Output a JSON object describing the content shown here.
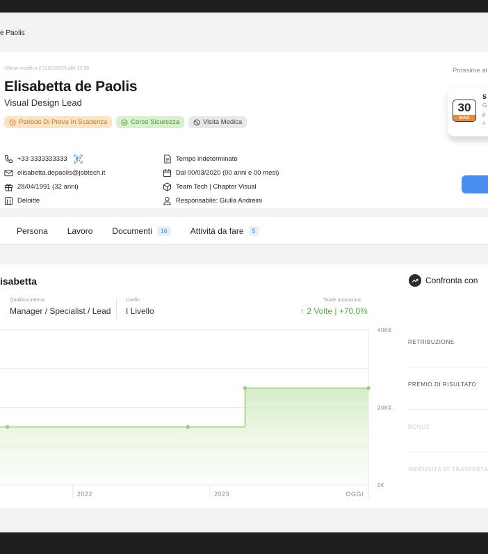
{
  "breadcrumb": "e Paolis",
  "profile": {
    "updated": "Ultima modifica il 31/01/2023 alle 12:08",
    "name": "Elisabetta de Paolis",
    "role": "Visual Design Lead",
    "badges": [
      "Periodo Di Prova In Scadenza",
      "Corso Sicurezza",
      "Visita Medica"
    ],
    "phone": "+33 3333333333",
    "email": "elisabetta.depaolis@jobtech.it",
    "birth": "28/04/1991 (32 anni)",
    "company": "Deloitte",
    "contract": "Tempo indeterminato",
    "since": "Dal 00/03/2020 (00 anni e 00 mesi)",
    "team": "Team Tech | Chapter Visual",
    "manager": "Responsabile: Giulia Andreini"
  },
  "upcoming": {
    "label": "Prossime at",
    "day": "30",
    "month": "MAG",
    "line1": "S",
    "line2": "G",
    "line3": "p",
    "line4": "A"
  },
  "tabs": [
    {
      "label": "Persona",
      "count": ""
    },
    {
      "label": "Lavoro",
      "count": ""
    },
    {
      "label": "Documenti",
      "count": "16"
    },
    {
      "label": "Attività da fare",
      "count": "5"
    }
  ],
  "career": {
    "name": "isabetta",
    "qualifica_label": "Qualifica interna",
    "qualifica_value": "Manager / Specialist / Lead",
    "livello_label": "Livello",
    "livello_value": "I Livello",
    "promo_label": "Totale promozioni",
    "promo_count": "↑ 2 Volte",
    "promo_pct": "+70,0%",
    "compare": "Confronta con",
    "metrics": [
      "RETRIBUZIONE",
      "PREMIO DI RISULTATO",
      "BONUS",
      "INDENNITÀ DI TRASFERTA"
    ]
  },
  "colors": {
    "accent_blue": "#4a8ff0",
    "line_green": "#9ccf7f",
    "promo_green": "#4fae3b"
  },
  "chart_data": {
    "type": "area",
    "x_ticks": [
      "2022",
      "2023",
      "OGGI"
    ],
    "y_ticks": [
      "40K€",
      "20K€",
      "0€"
    ],
    "ylim": [
      0,
      40000
    ],
    "points": [
      {
        "x": 0.0,
        "y": 15000
      },
      {
        "x": 0.02,
        "y": 15000
      },
      {
        "x": 0.51,
        "y": 15000
      },
      {
        "x": 0.665,
        "y": 15000
      },
      {
        "x": 0.665,
        "y": 25000
      },
      {
        "x": 1.0,
        "y": 25000
      }
    ],
    "markers": [
      {
        "x": 0.02,
        "y": 15000
      },
      {
        "x": 0.51,
        "y": 15000
      },
      {
        "x": 0.665,
        "y": 25000
      },
      {
        "x": 1.0,
        "y": 25000
      }
    ],
    "grid": true
  }
}
